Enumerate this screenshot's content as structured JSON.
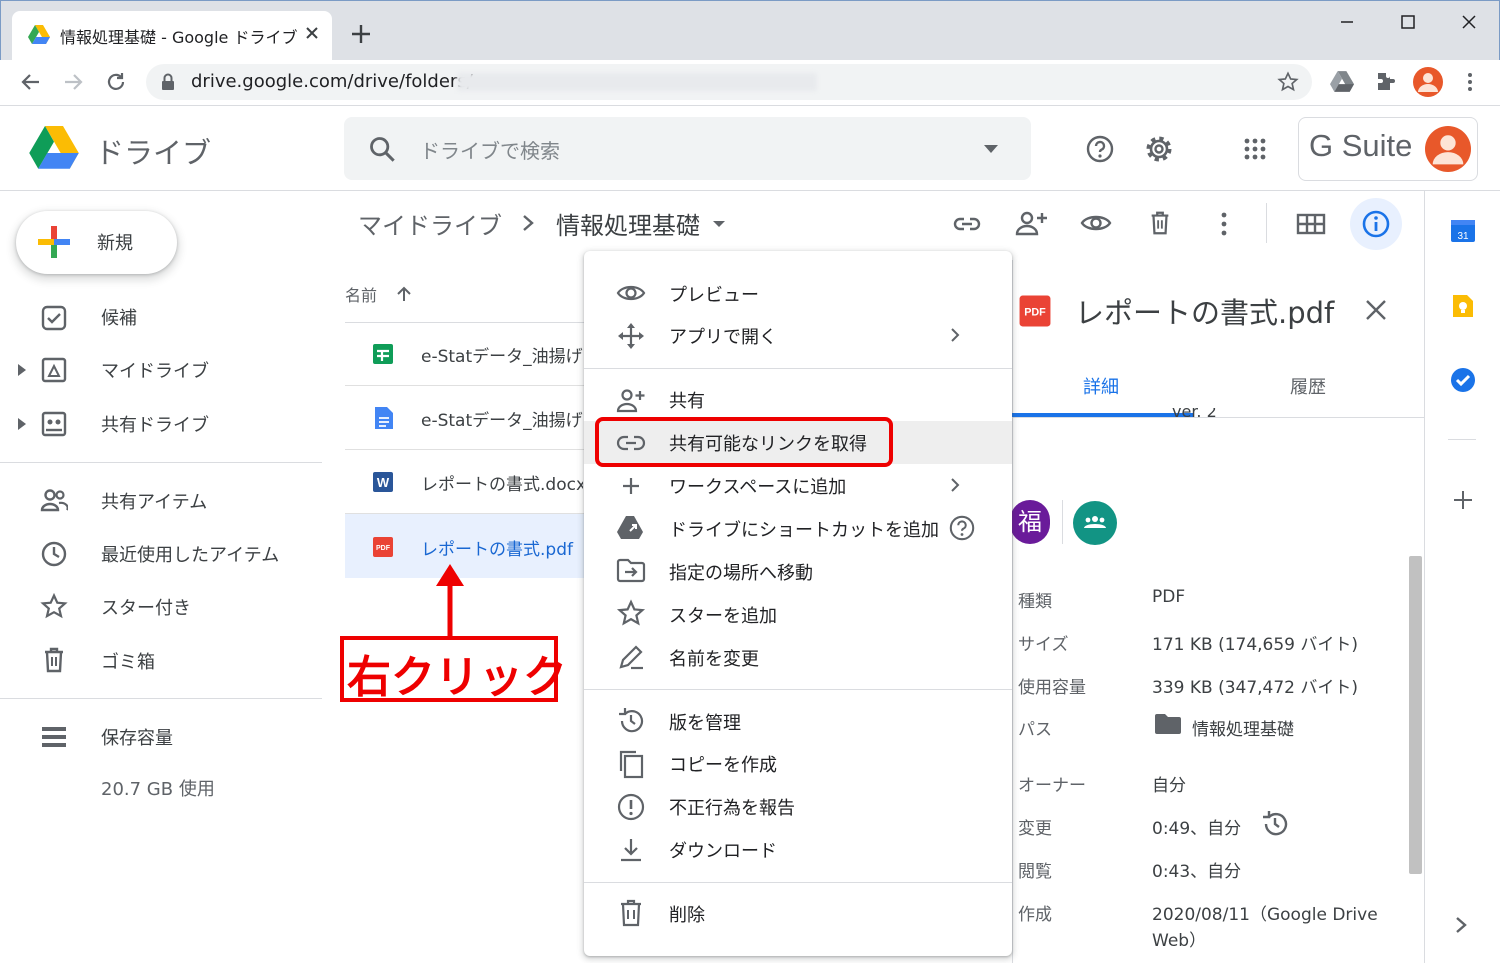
{
  "browser": {
    "tab_title": "情報処理基礎 - Google ドライブ",
    "url": "drive.google.com/drive/folders/"
  },
  "header": {
    "brand": "ドライブ",
    "search_placeholder": "ドライブで検索",
    "gsuite": "G Suite"
  },
  "sidebar": {
    "new_label": "新規",
    "items": [
      {
        "label": "候補"
      },
      {
        "label": "マイドライブ"
      },
      {
        "label": "共有ドライブ"
      },
      {
        "label": "共有アイテム"
      },
      {
        "label": "最近使用したアイテム"
      },
      {
        "label": "スター付き"
      },
      {
        "label": "ゴミ箱"
      },
      {
        "label": "保存容量"
      }
    ],
    "storage_used": "20.7 GB 使用"
  },
  "breadcrumb": {
    "root": "マイドライブ",
    "current": "情報処理基礎"
  },
  "file_list": {
    "name_header": "名前",
    "files": [
      {
        "name": "e-Statデータ_油揚げ",
        "type": "sheets"
      },
      {
        "name": "e-Statデータ_油揚げ.",
        "type": "docs"
      },
      {
        "name": "レポートの書式.docx",
        "type": "word"
      },
      {
        "name": "レポートの書式.pdf",
        "type": "pdf"
      }
    ]
  },
  "annotation": "右クリック",
  "context_menu": [
    {
      "label": "プレビュー"
    },
    {
      "label": "アプリで開く"
    },
    {
      "label": "共有"
    },
    {
      "label": "共有可能なリンクを取得"
    },
    {
      "label": "ワークスペースに追加"
    },
    {
      "label": "ドライブにショートカットを追加"
    },
    {
      "label": "指定の場所へ移動"
    },
    {
      "label": "スターを追加"
    },
    {
      "label": "名前を変更"
    },
    {
      "label": "版を管理"
    },
    {
      "label": "コピーを作成"
    },
    {
      "label": "不正行為を報告"
    },
    {
      "label": "ダウンロード"
    },
    {
      "label": "削除"
    }
  ],
  "details": {
    "title": "レポートの書式.pdf",
    "pdf_badge": "PDF",
    "tab_detail": "詳細",
    "tab_history": "履歴",
    "version": "ver. 2",
    "owner_avatar": "福",
    "rows": [
      {
        "key": "種類",
        "value": "PDF"
      },
      {
        "key": "サイズ",
        "value": "171 KB (174,659 バイト)"
      },
      {
        "key": "使用容量",
        "value": "339 KB (347,472 バイト)"
      },
      {
        "key": "パス",
        "value": "情報処理基礎"
      },
      {
        "key": "オーナー",
        "value": "自分"
      },
      {
        "key": "変更",
        "value": "0:49、自分"
      },
      {
        "key": "閲覧",
        "value": "0:43、自分"
      },
      {
        "key": "作成",
        "value": "2020/08/11（Google Drive"
      }
    ],
    "created_line2": "Web）"
  },
  "colors": {
    "accent": "#1a73e8",
    "annotation_red": "#e00000",
    "selected_row": "#e8f0fe"
  }
}
